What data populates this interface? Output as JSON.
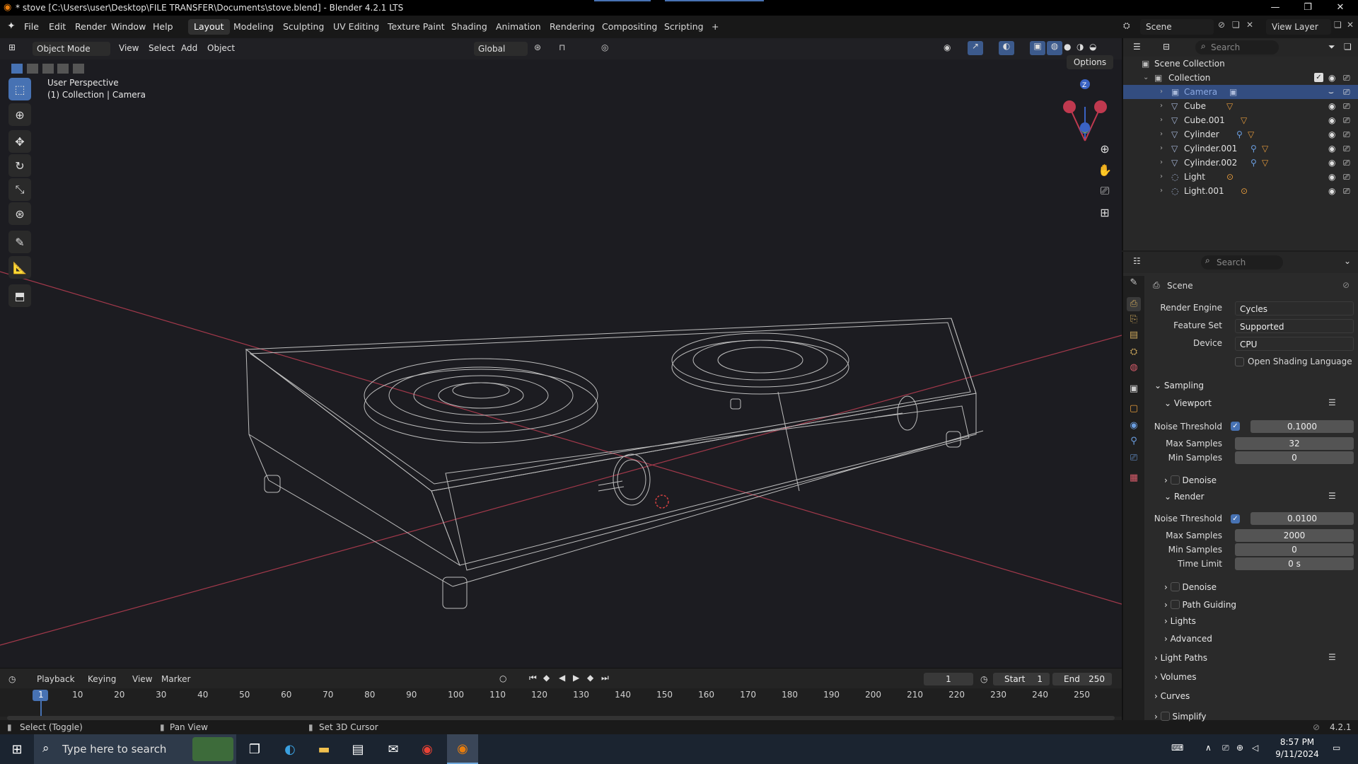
{
  "titlebar": {
    "title": "* stove [C:\\Users\\user\\Desktop\\FILE TRANSFER\\Documents\\stove.blend] - Blender 4.2.1 LTS",
    "minimize": "—",
    "restore": "❐",
    "close": "✕"
  },
  "menu": [
    "File",
    "Edit",
    "Render",
    "Window",
    "Help"
  ],
  "workspaces": [
    "Layout",
    "Modeling",
    "Sculpting",
    "UV Editing",
    "Texture Paint",
    "Shading",
    "Animation",
    "Rendering",
    "Compositing",
    "Scripting"
  ],
  "workspace_add": "+",
  "scene": {
    "label": "Scene",
    "view_layer": "View Layer"
  },
  "viewport": {
    "mode": "Object Mode",
    "menus": [
      "View",
      "Select",
      "Add",
      "Object"
    ],
    "orientation": "Global",
    "options": "Options",
    "info_line1": "User Perspective",
    "info_line2": "(1) Collection | Camera",
    "gizmo_axis": "Z"
  },
  "outliner": {
    "search_placeholder": "Search",
    "scene_collection": "Scene Collection",
    "collection": "Collection",
    "items": [
      {
        "name": "Camera",
        "icon": "camera-icon",
        "selected": true
      },
      {
        "name": "Cube",
        "icon": "mesh-icon"
      },
      {
        "name": "Cube.001",
        "icon": "mesh-icon"
      },
      {
        "name": "Cylinder",
        "icon": "mesh-icon"
      },
      {
        "name": "Cylinder.001",
        "icon": "mesh-icon"
      },
      {
        "name": "Cylinder.002",
        "icon": "mesh-icon"
      },
      {
        "name": "Light",
        "icon": "light-icon"
      },
      {
        "name": "Light.001",
        "icon": "light-icon"
      }
    ]
  },
  "properties": {
    "search_placeholder": "Search",
    "context": "Scene",
    "render_engine_label": "Render Engine",
    "render_engine": "Cycles",
    "feature_set_label": "Feature Set",
    "feature_set": "Supported",
    "device_label": "Device",
    "device": "CPU",
    "osl": "Open Shading Language",
    "sampling": "Sampling",
    "viewport": "Viewport",
    "noise_threshold_label": "Noise Threshold",
    "vp_noise_threshold": "0.1000",
    "max_samples_label": "Max Samples",
    "vp_max_samples": "32",
    "min_samples_label": "Min Samples",
    "vp_min_samples": "0",
    "denoise": "Denoise",
    "render": "Render",
    "r_noise_threshold": "0.0100",
    "r_max_samples": "2000",
    "r_min_samples": "0",
    "time_limit_label": "Time Limit",
    "r_time_limit": "0 s",
    "path_guiding": "Path Guiding",
    "lights": "Lights",
    "advanced": "Advanced",
    "light_paths": "Light Paths",
    "volumes": "Volumes",
    "curves": "Curves",
    "simplify": "Simplify"
  },
  "timeline": {
    "menus": [
      "Playback",
      "Keying",
      "View",
      "Marker"
    ],
    "current_frame": "1",
    "start_label": "Start",
    "start": "1",
    "end_label": "End",
    "end": "250",
    "ruler": [
      "1",
      "10",
      "20",
      "30",
      "40",
      "50",
      "60",
      "70",
      "80",
      "90",
      "100",
      "110",
      "120",
      "130",
      "140",
      "150",
      "160",
      "170",
      "180",
      "190",
      "200",
      "210",
      "220",
      "230",
      "240",
      "250"
    ]
  },
  "status": {
    "select": "Select (Toggle)",
    "pan": "Pan View",
    "cursor": "Set 3D Cursor",
    "version": "4.2.1"
  },
  "taskbar": {
    "search_placeholder": "Type here to search",
    "time": "8:57 PM",
    "date": "9/11/2024"
  },
  "colors": {
    "accent": "#4772b3",
    "selection": "#334d80",
    "x_axis": "#c0394f",
    "y_axis": "#8aa83f",
    "z_axis": "#3a63c4"
  }
}
